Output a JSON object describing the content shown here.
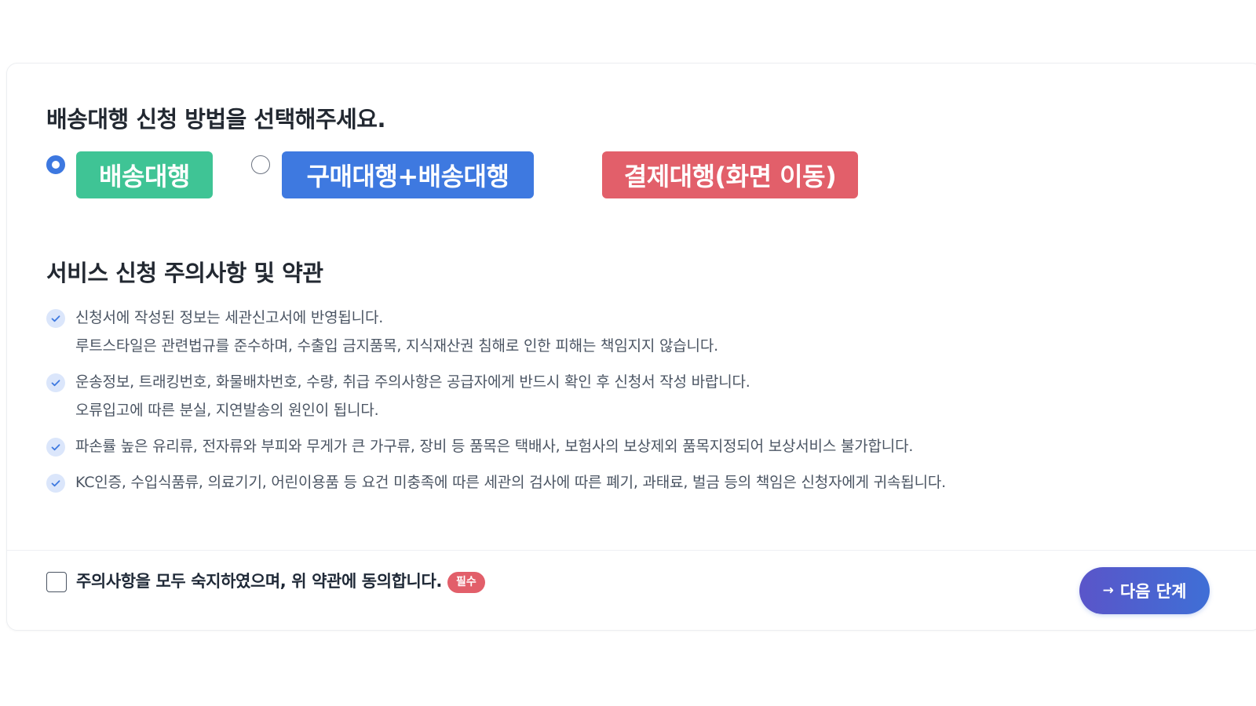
{
  "method_section": {
    "title": "배송대행 신청 방법을 선택해주세요.",
    "options": [
      {
        "label": "배송대행",
        "selected": true,
        "color": "#3fc495"
      },
      {
        "label": "구매대행+배송대행",
        "selected": false,
        "color": "#3e79e0"
      },
      {
        "label": "결제대행(화면 이동)",
        "color": "#e25f6a"
      }
    ]
  },
  "terms_section": {
    "title": "서비스 신청 주의사항 및 약관",
    "items": [
      {
        "icon": "check-icon",
        "lines": [
          "신청서에 작성된 정보는 세관신고서에 반영됩니다.",
          "루트스타일은 관련법규를 준수하며, 수출입 금지품목, 지식재산권 침해로 인한 피해는 책임지지 않습니다."
        ]
      },
      {
        "icon": "check-icon",
        "lines": [
          "운송정보, 트래킹번호, 화물배차번호, 수량, 취급 주의사항은 공급자에게 반드시 확인 후 신청서 작성 바랍니다.",
          "오류입고에 따른 분실, 지연발송의 원인이 됩니다."
        ]
      },
      {
        "icon": "check-icon",
        "lines": [
          "파손률 높은 유리류, 전자류와 부피와 무게가 큰 가구류, 장비 등 품목은 택배사, 보험사의 보상제외 품목지정되어 보상서비스 불가합니다."
        ]
      },
      {
        "icon": "check-icon",
        "lines": [
          "KC인증, 수입식품류, 의료기기, 어린이용품 등 요건 미충족에 따른 세관의 검사에 따른 폐기, 과태료, 벌금 등의 책임은 신청자에게 귀속됩니다."
        ]
      }
    ]
  },
  "agreement": {
    "label": "주의사항을 모두 숙지하였으며, 위 약관에 동의합니다.",
    "checked": false,
    "required_badge": "필수"
  },
  "next_button": {
    "icon": "arrow-right-icon",
    "label": "다음 단계"
  },
  "colors": {
    "accent_blue": "#3e79e0",
    "accent_green": "#3fc495",
    "accent_red": "#e25f6a",
    "check_bg": "#dbe6fb"
  }
}
